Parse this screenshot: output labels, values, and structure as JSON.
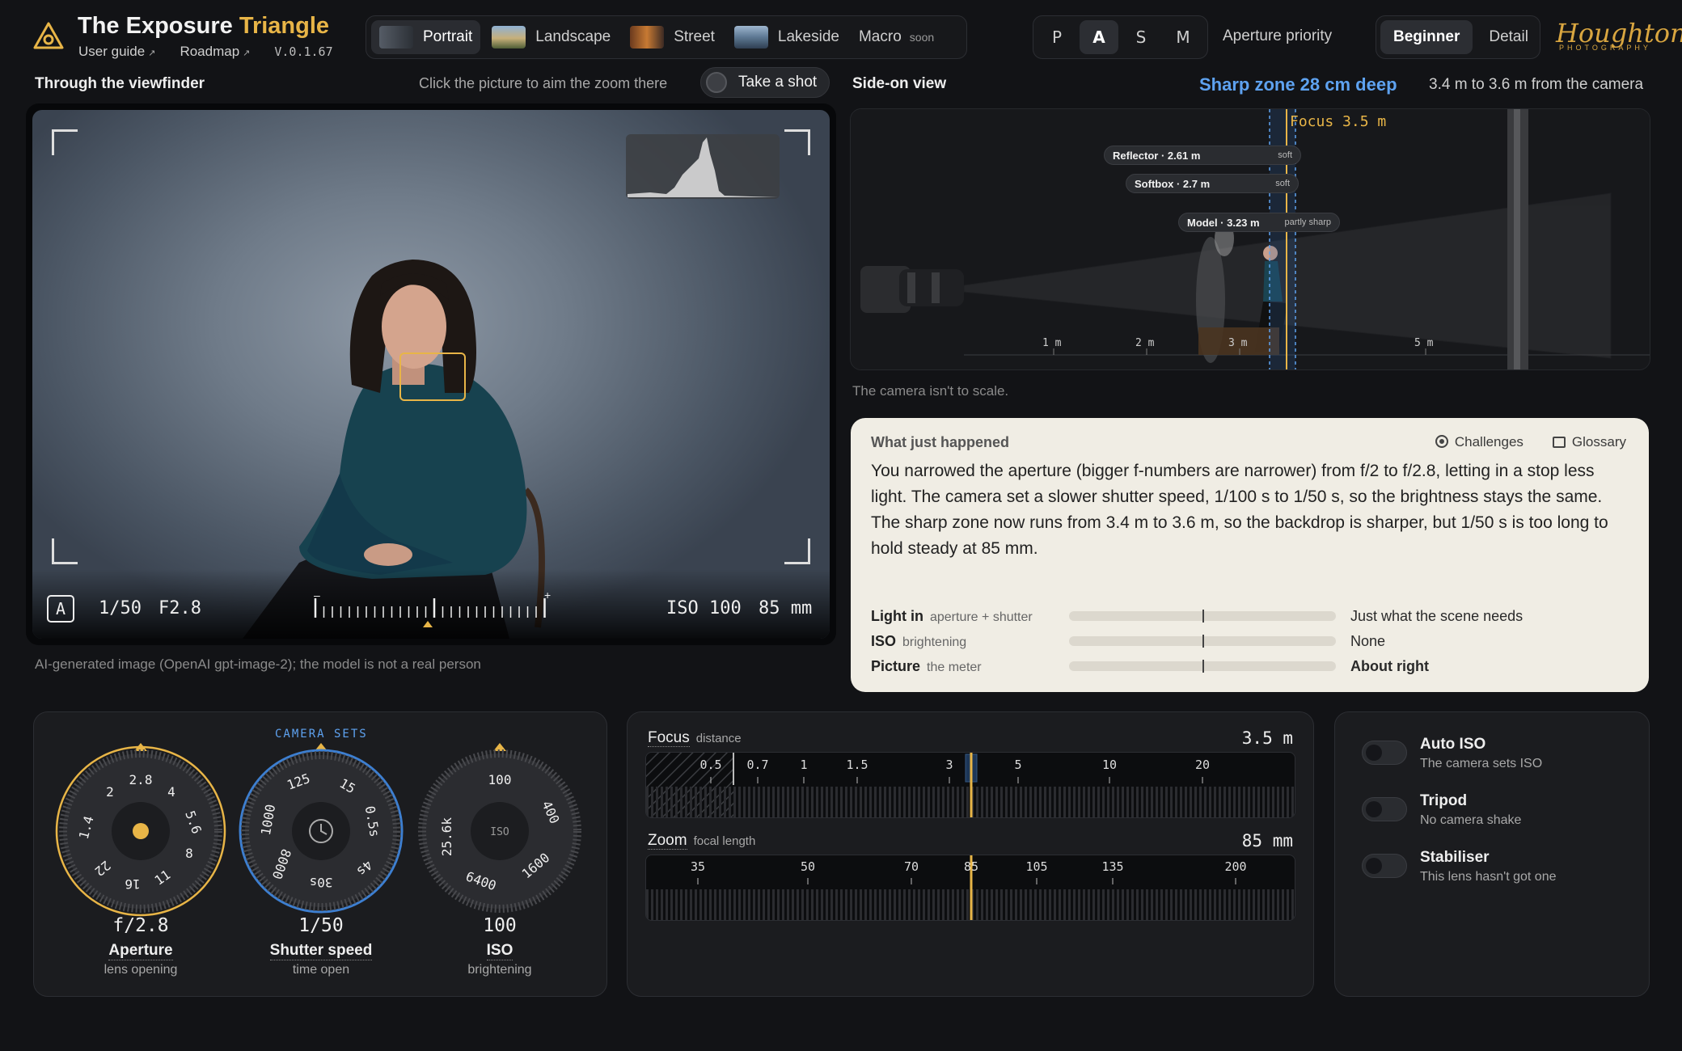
{
  "header": {
    "title_main": "The Exposure",
    "title_accent": "Triangle",
    "user_guide": "User guide",
    "roadmap": "Roadmap",
    "version": "V.0.1.67",
    "brand": "Houghton",
    "brand_sub": "PHOTOGRAPHY"
  },
  "scenes": [
    {
      "label": "Portrait",
      "active": true
    },
    {
      "label": "Landscape",
      "active": false
    },
    {
      "label": "Street",
      "active": false
    },
    {
      "label": "Lakeside",
      "active": false
    },
    {
      "label": "Macro",
      "soon": "soon",
      "active": false
    }
  ],
  "modes": {
    "items": [
      "P",
      "A",
      "S",
      "M"
    ],
    "active": "A",
    "label": "Aperture priority"
  },
  "levels": {
    "items": [
      "Beginner",
      "Detail"
    ],
    "active": "Beginner"
  },
  "viewfinder": {
    "title": "Through the viewfinder",
    "hint": "Click the picture to aim the zoom there",
    "shot_button": "Take a shot",
    "mode_badge": "A",
    "shutter": "1/50",
    "aperture": "F2.8",
    "iso": "ISO 100",
    "focal": "85 mm",
    "meter_minus": "–",
    "meter_plus": "+",
    "meter_level": 0.5,
    "caption": "AI-generated image (OpenAI gpt-image-2); the model is not a real person"
  },
  "sideview": {
    "title": "Side-on view",
    "sharp_zone": "Sharp zone 28 cm deep",
    "sharp_range": "3.4 m to 3.6 m from the camera",
    "focus_label": "Focus 3.5 m",
    "tags": {
      "reflector": "Reflector · 2.61 m",
      "reflector_state": "soft",
      "softbox": "Softbox · 2.7 m",
      "softbox_state": "soft",
      "model": "Model · 3.23 m",
      "model_state": "partly sharp"
    },
    "axis_labels": [
      "1 m",
      "2 m",
      "3 m",
      "5 m"
    ],
    "note": "The camera isn't to scale."
  },
  "what_happened": {
    "title": "What just happened",
    "challenges": "Challenges",
    "glossary": "Glossary",
    "body": "You narrowed the aperture (bigger f-numbers are narrower) from f/2 to f/2.8, letting in a stop less light. The camera set a slower shutter speed, 1/100 s to 1/50 s, so the brightness stays the same. The sharp zone now runs from 3.4 m to 3.6 m, so the backdrop is sharper, but 1/50 s is too long to hold steady at 85 mm.",
    "rows": [
      {
        "name": "Light in",
        "sub": "aperture + shutter",
        "value": "Just what the scene needs",
        "level": 0.5
      },
      {
        "name": "ISO",
        "sub": "brightening",
        "value": "None",
        "level": 0.5
      },
      {
        "name": "Picture",
        "sub": "the meter",
        "value": "About right",
        "level": 0.5
      }
    ]
  },
  "dials": {
    "camera_sets": "CAMERA SETS",
    "aperture": {
      "value": "f/2.8",
      "name": "Aperture",
      "sub": "lens opening",
      "scale": [
        "2.8",
        "4",
        "5.6",
        "8",
        "11",
        "16",
        "22",
        "1.4",
        "2"
      ]
    },
    "shutter": {
      "value": "1/50",
      "name": "Shutter speed",
      "sub": "time open",
      "scale": [
        "125",
        "15",
        "0.5s",
        "4s",
        "30s",
        "8000",
        "1000"
      ]
    },
    "iso": {
      "value": "100",
      "name": "ISO",
      "sub": "brightening",
      "center": "ISO",
      "scale": [
        "100",
        "400",
        "1600",
        "6400",
        "25.6k"
      ]
    }
  },
  "focus": {
    "title": "Focus",
    "sub": "distance",
    "value": "3.5 m",
    "ticks": [
      "0.5",
      "0.7",
      "1",
      "1.5",
      "3",
      "5",
      "10",
      "20"
    ]
  },
  "zoom": {
    "title": "Zoom",
    "sub": "focal length",
    "value": "85 mm",
    "ticks": [
      "35",
      "50",
      "70",
      "85",
      "105",
      "135",
      "200"
    ]
  },
  "toggles": [
    {
      "name": "Auto ISO",
      "sub": "The camera sets ISO"
    },
    {
      "name": "Tripod",
      "sub": "No camera shake"
    },
    {
      "name": "Stabiliser",
      "sub": "This lens hasn't got one"
    }
  ],
  "colors": {
    "accent": "#e8b547",
    "blue": "#5ea2f0",
    "bg": "#121316"
  }
}
